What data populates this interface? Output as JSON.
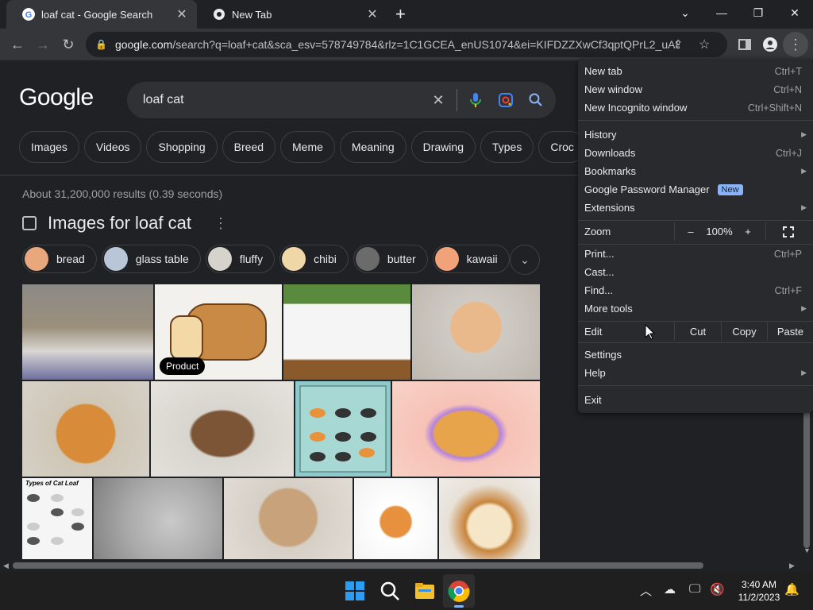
{
  "tabs": [
    {
      "title": "loaf cat - Google Search"
    },
    {
      "title": "New Tab"
    }
  ],
  "address": {
    "host": "google.com",
    "path": "/search?q=loaf+cat&sca_esv=578749784&rlz=1C1GCEA_enUS1074&ei=KIFDZZXwCf3qptQPrL2_uA8..."
  },
  "google": {
    "logo": "Google",
    "query": "loaf cat",
    "chips": [
      "Images",
      "Videos",
      "Shopping",
      "Breed",
      "Meme",
      "Meaning",
      "Drawing",
      "Types",
      "Croc"
    ],
    "stats": "About 31,200,000 results (0.39 seconds)",
    "images_heading": "Images for loaf cat",
    "refine_chips": [
      "bread",
      "glass table",
      "fluffy",
      "chibi",
      "butter",
      "kawaii"
    ],
    "product_badge": "Product"
  },
  "menu": {
    "items": [
      {
        "label": "New tab",
        "shortcut": "Ctrl+T"
      },
      {
        "label": "New window",
        "shortcut": "Ctrl+N"
      },
      {
        "label": "New Incognito window",
        "shortcut": "Ctrl+Shift+N"
      },
      {
        "label": "History"
      },
      {
        "label": "Downloads",
        "shortcut": "Ctrl+J"
      },
      {
        "label": "Bookmarks"
      },
      {
        "label": "Google Password Manager",
        "badge": "New"
      },
      {
        "label": "Extensions"
      },
      {
        "label": "Print...",
        "shortcut": "Ctrl+P"
      },
      {
        "label": "Cast..."
      },
      {
        "label": "Find...",
        "shortcut": "Ctrl+F"
      },
      {
        "label": "More tools"
      },
      {
        "label": "Settings"
      },
      {
        "label": "Help"
      },
      {
        "label": "Exit"
      }
    ],
    "zoom": {
      "label": "Zoom",
      "minus": "–",
      "value": "100%",
      "plus": "+"
    },
    "edit": {
      "label": "Edit",
      "cut": "Cut",
      "copy": "Copy",
      "paste": "Paste"
    }
  },
  "taskbar": {
    "time": "3:40 AM",
    "date": "11/2/2023"
  },
  "colors": {
    "accent": "#8ab4f8",
    "page_bg": "#202124",
    "menu_bg": "#292a2d"
  }
}
